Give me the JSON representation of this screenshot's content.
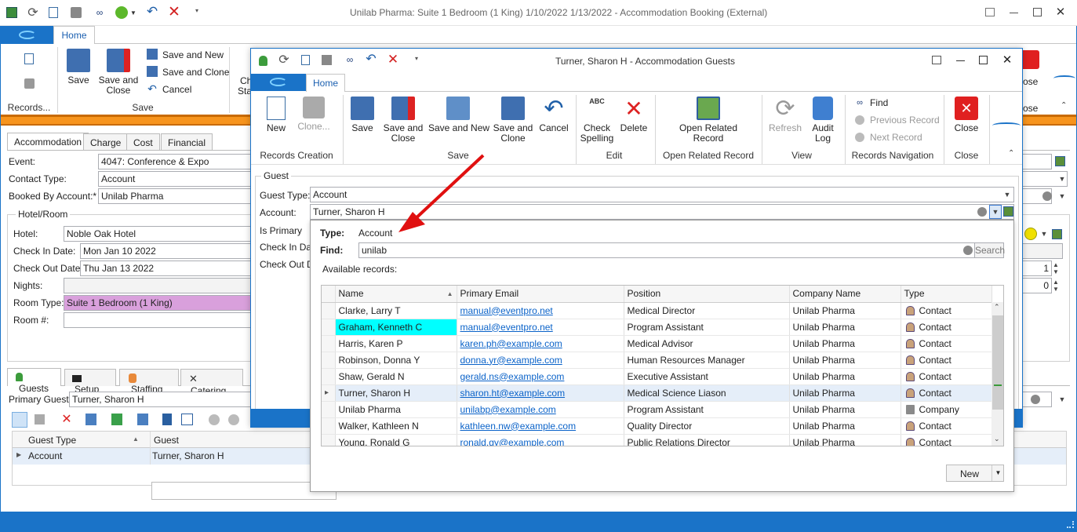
{
  "main_window": {
    "title": "Unilab Pharma: Suite 1 Bedroom (1 King) 1/10/2022 1/13/2022  - Accommodation Booking (External)",
    "home_tab": "Home",
    "ribbon": {
      "save": "Save",
      "save_and_close": "Save and Close",
      "save_and_new": "Save and New",
      "save_and_clone": "Save and Clone",
      "cancel": "Cancel",
      "records_group": "Records...",
      "save_group": "Save",
      "ch_partial": "Ch",
      "sta_partial": "Sta",
      "close_partial": "ose",
      "close_group_partial": "ose"
    },
    "tabs": [
      "Accommodation",
      "Charge",
      "Cost",
      "Financial"
    ],
    "fields": {
      "event_label": "Event:",
      "event_value": "4047: Conference & Expo",
      "contact_type_label": "Contact Type:",
      "contact_type_value": "Account",
      "booked_by_label": "Booked By Account:*",
      "booked_by_value": "Unilab Pharma"
    },
    "hotel_section": {
      "title": "Hotel/Room",
      "hotel_label": "Hotel:",
      "hotel_value": "Noble Oak Hotel",
      "check_in_label": "Check In Date:",
      "check_in_value": "Mon Jan 10 2022",
      "check_out_label": "Check Out Date:",
      "check_out_value": "Thu Jan 13 2022",
      "nights_label": "Nights:",
      "room_type_label": "Room Type:",
      "room_type_value": "Suite 1 Bedroom (1 King)",
      "room_num_label": "Room #:",
      "spin1": "1",
      "spin2": "0"
    },
    "bottom_tabs": [
      "Guests",
      "Setup",
      "Staffing",
      "Catering"
    ],
    "primary_guest_label": "Primary Guest:",
    "primary_guest_value": "Turner, Sharon H",
    "guest_grid": {
      "headers": [
        "Guest Type",
        "Guest"
      ],
      "rows": [
        [
          "Account",
          "Turner, Sharon H"
        ]
      ]
    }
  },
  "dialog": {
    "title": "Turner, Sharon H - Accommodation Guests",
    "home_tab": "Home",
    "ribbon": {
      "new": "New",
      "clone": "Clone...",
      "records_creation": "Records Creation",
      "save": "Save",
      "save_and_close": "Save and Close",
      "save_and_new": "Save and New",
      "save_and_clone": "Save and Clone",
      "cancel": "Cancel",
      "save_group": "Save",
      "check_spelling": "Check Spelling",
      "delete": "Delete",
      "edit_group": "Edit",
      "open_related": "Open Related Record",
      "open_related_group": "Open Related Record",
      "refresh": "Refresh",
      "audit_log": "Audit Log",
      "view_group": "View",
      "find": "Find",
      "previous_record": "Previous Record",
      "next_record": "Next Record",
      "records_navigation": "Records Navigation",
      "close": "Close",
      "close_group": "Close",
      "abc": "ABC"
    },
    "guest_section": "Guest",
    "guest_type_label": "Guest Type:",
    "guest_type_value": "Account",
    "account_label": "Account:",
    "account_value": "Turner, Sharon H",
    "is_primary_label": "Is Primary",
    "check_in_label": "Check In Date",
    "check_out_label": "Check Out Da"
  },
  "lookup": {
    "type_label": "Type:",
    "type_value": "Account",
    "find_label": "Find:",
    "find_value": "unilab",
    "search_button": "Search",
    "available_records": "Available records:",
    "headers": [
      "Name",
      "Primary Email",
      "Position",
      "Company Name",
      "Type"
    ],
    "rows": [
      {
        "name": "Clarke, Larry T",
        "email": "manual@eventpro.net",
        "position": "Medical Director",
        "company": "Unilab Pharma",
        "type": "Contact"
      },
      {
        "name": "Graham, Kenneth C",
        "email": "manual@eventpro.net",
        "position": "Program Assistant",
        "company": "Unilab Pharma",
        "type": "Contact"
      },
      {
        "name": "Harris, Karen P",
        "email": "karen.ph@example.com",
        "position": "Medical Advisor",
        "company": "Unilab Pharma",
        "type": "Contact"
      },
      {
        "name": "Robinson, Donna Y",
        "email": "donna.yr@example.com",
        "position": "Human Resources Manager",
        "company": "Unilab Pharma",
        "type": "Contact"
      },
      {
        "name": "Shaw, Gerald N",
        "email": "gerald.ns@example.com",
        "position": "Executive Assistant",
        "company": "Unilab Pharma",
        "type": "Contact"
      },
      {
        "name": "Turner, Sharon H",
        "email": "sharon.ht@example.com",
        "position": "Medical Science Liason",
        "company": "Unilab Pharma",
        "type": "Contact"
      },
      {
        "name": "Unilab Pharma",
        "email": "unilabp@example.com",
        "position": "Program Assistant",
        "company": "Unilab Pharma",
        "type": "Company"
      },
      {
        "name": "Walker, Kathleen N",
        "email": "kathleen.nw@example.com",
        "position": "Quality Director",
        "company": "Unilab Pharma",
        "type": "Contact"
      },
      {
        "name": "Young, Ronald G",
        "email": "ronald.gy@example.com",
        "position": "Public Relations Director",
        "company": "Unilab Pharma",
        "type": "Contact"
      }
    ],
    "new_button": "New"
  },
  "colors": {
    "accent_blue": "#1a73c8",
    "orange_bar": "#f7941d",
    "highlight_cyan": "#00ffff",
    "room_type_pink": "#d9a0dc",
    "arrow_red": "#e01010"
  }
}
